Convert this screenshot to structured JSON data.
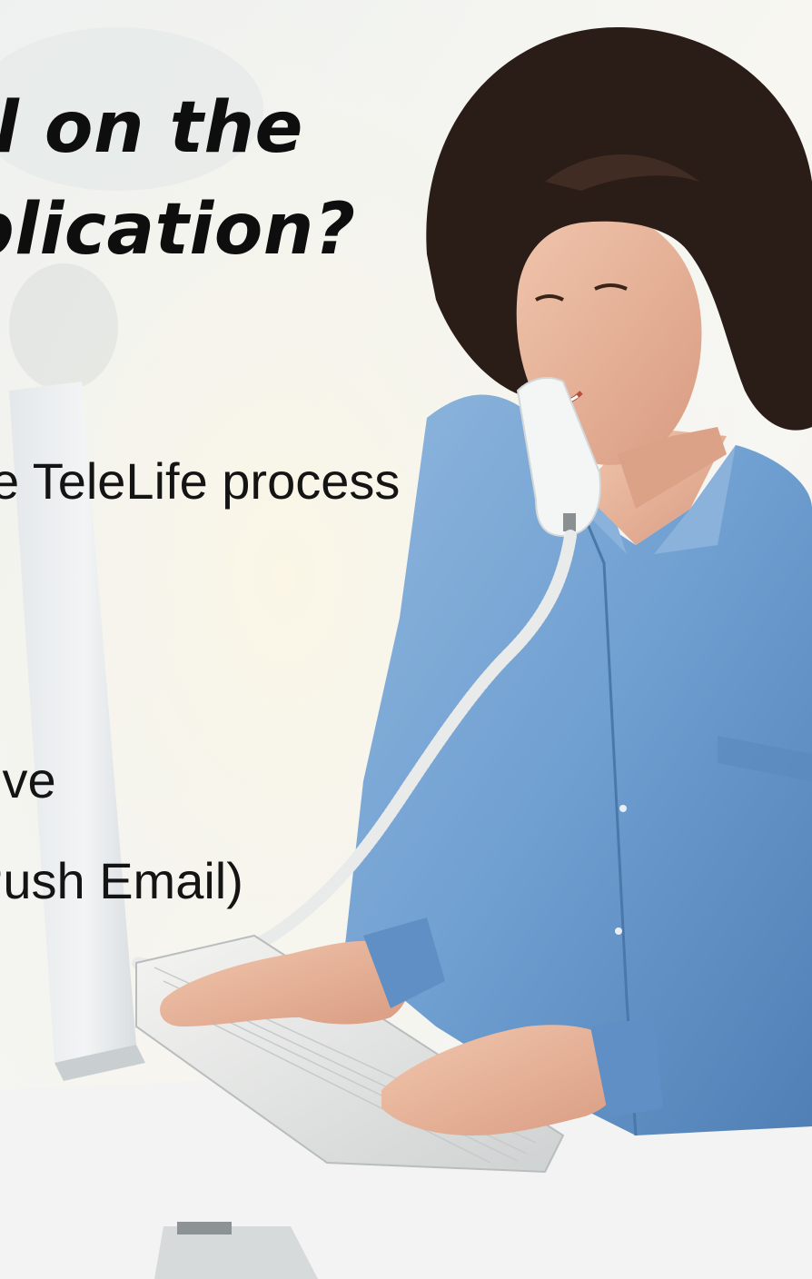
{
  "slide": {
    "title_line1": "l on the",
    "title_line2": "plication?",
    "bullets": [
      "e TeleLife process",
      "ive",
      "Push Email)"
    ]
  },
  "photo": {
    "subject": "woman-on-phone-typing-icon"
  },
  "colors": {
    "background": "#f4f5f4",
    "shirt": "#6f9fd1",
    "hair": "#2a1c16",
    "skin": "#e8b49a",
    "text": "#141414"
  }
}
